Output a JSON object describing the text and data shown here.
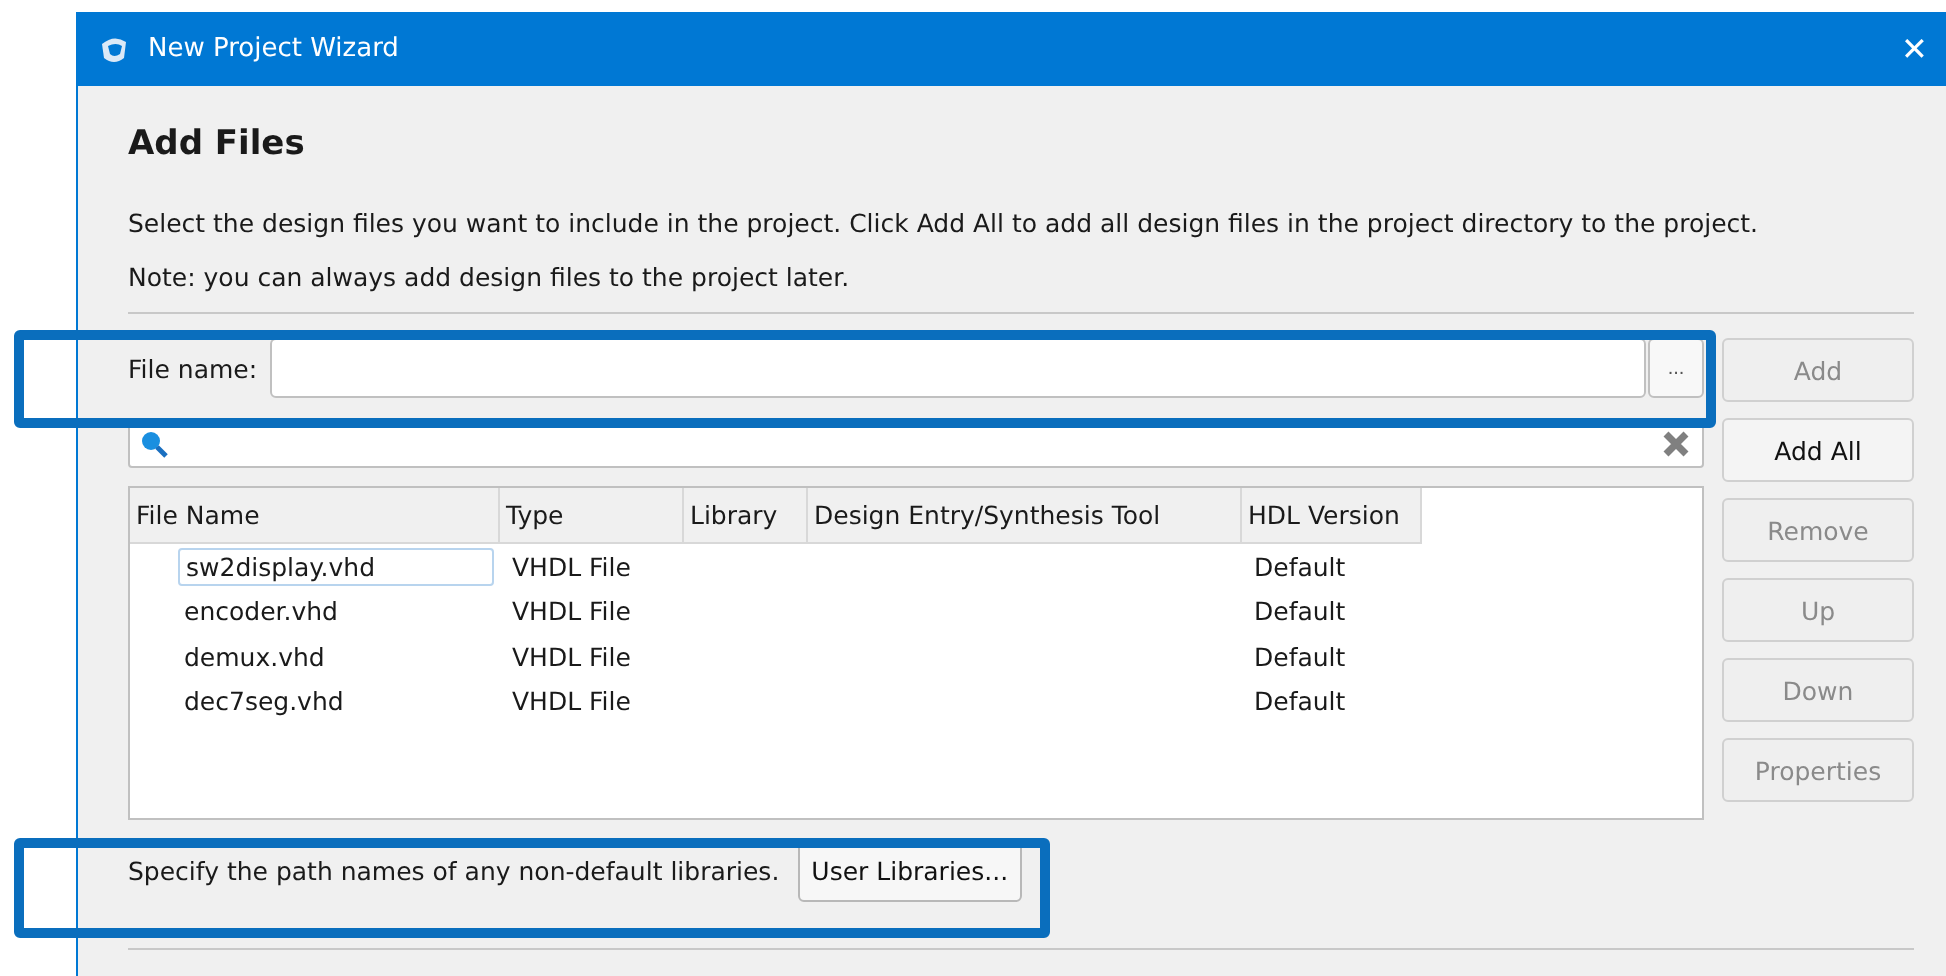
{
  "window": {
    "title": "New Project Wizard",
    "close": "✕"
  },
  "heading": "Add Files",
  "description": [
    "Select the design files you want to include in the project. Click Add All to add all design files in the project directory to the project.",
    "Note: you can always add design files to the project later."
  ],
  "file_name": {
    "label": "File name:",
    "browse": "..."
  },
  "table": {
    "columns": [
      "File Name",
      "Type",
      "Library",
      "Design Entry/Synthesis Tool",
      "HDL Version"
    ],
    "rows": [
      {
        "cells": [
          "sw2display.vhd",
          "VHDL File",
          "",
          "",
          "Default"
        ],
        "selected": true
      },
      {
        "cells": [
          "encoder.vhd",
          "VHDL File",
          "",
          "",
          "Default"
        ],
        "selected": false
      },
      {
        "cells": [
          "demux.vhd",
          "VHDL File",
          "",
          "",
          "Default"
        ],
        "selected": false
      },
      {
        "cells": [
          "dec7seg.vhd",
          "VHDL File",
          "",
          "",
          "Default"
        ],
        "selected": false
      }
    ]
  },
  "buttons": [
    {
      "label": "Add",
      "disabled": true
    },
    {
      "label": "Add All",
      "disabled": false
    },
    {
      "label": "Remove",
      "disabled": true
    },
    {
      "label": "Up",
      "disabled": true
    },
    {
      "label": "Down",
      "disabled": true
    },
    {
      "label": "Properties",
      "disabled": true
    }
  ],
  "libraries": {
    "text": "Specify the path names of any non-default libraries.",
    "button": "User Libraries..."
  },
  "highlights": [
    {
      "kind": "box"
    },
    {
      "kind": "box"
    }
  ]
}
